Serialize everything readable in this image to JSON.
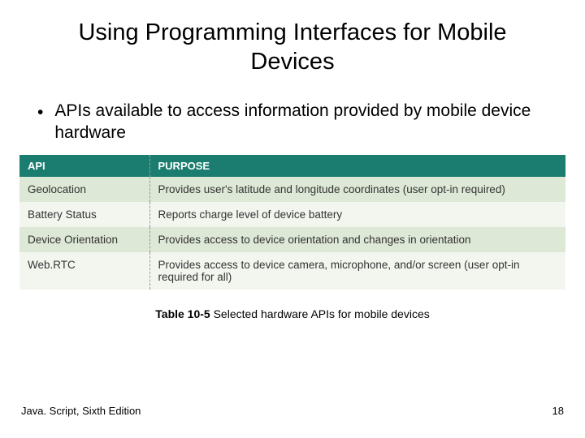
{
  "title": "Using Programming Interfaces for Mobile Devices",
  "bullet": "APIs available to access information provided by mobile device hardware",
  "table": {
    "headers": {
      "api": "API",
      "purpose": "PURPOSE"
    },
    "rows": [
      {
        "api": "Geolocation",
        "purpose": "Provides user's latitude and longitude coordinates (user opt-in required)"
      },
      {
        "api": "Battery Status",
        "purpose": "Reports charge level of device battery"
      },
      {
        "api": "Device Orientation",
        "purpose": "Provides access to device orientation and changes in orientation"
      },
      {
        "api": "Web.RTC",
        "purpose": "Provides access to device camera, microphone, and/or screen (user opt-in required for all)"
      }
    ]
  },
  "caption": {
    "label": "Table 10-5",
    "text": " Selected hardware APIs for mobile devices"
  },
  "footer": {
    "left": "Java. Script, Sixth Edition",
    "right": "18"
  }
}
